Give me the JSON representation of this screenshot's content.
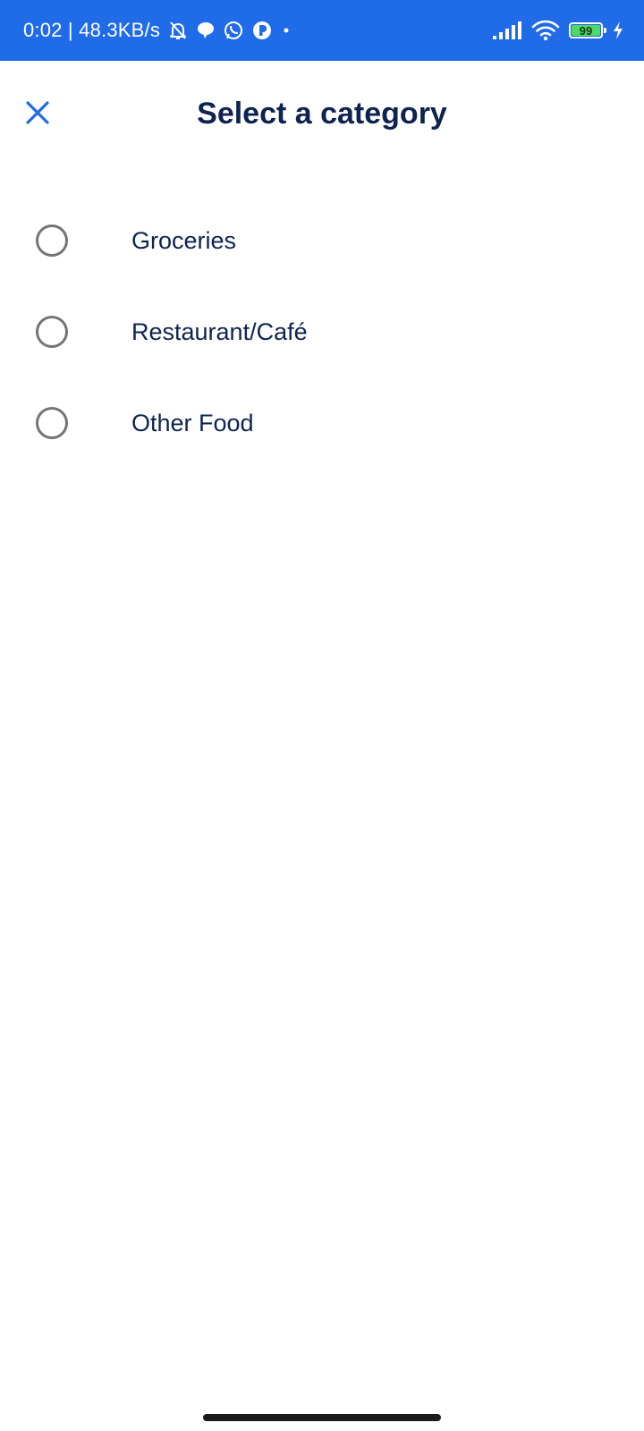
{
  "status_bar": {
    "time_and_speed": "0:02 | 48.3KB/s",
    "battery_level": "99",
    "background_color": "#1f6be8",
    "icons_left": [
      "bell-off-icon",
      "chat-bubble-icon",
      "whatsapp-icon",
      "app-circle-icon",
      "dot-icon"
    ],
    "icons_right": [
      "signal-icon",
      "wifi-icon",
      "battery-icon",
      "charging-bolt-icon"
    ]
  },
  "header": {
    "title": "Select a category",
    "close_icon": "close-icon",
    "accent_color": "#1f6be8",
    "title_color": "#0f2350"
  },
  "options": [
    {
      "label": "Groceries",
      "selected": false
    },
    {
      "label": "Restaurant/Café",
      "selected": false
    },
    {
      "label": "Other Food",
      "selected": false
    }
  ]
}
